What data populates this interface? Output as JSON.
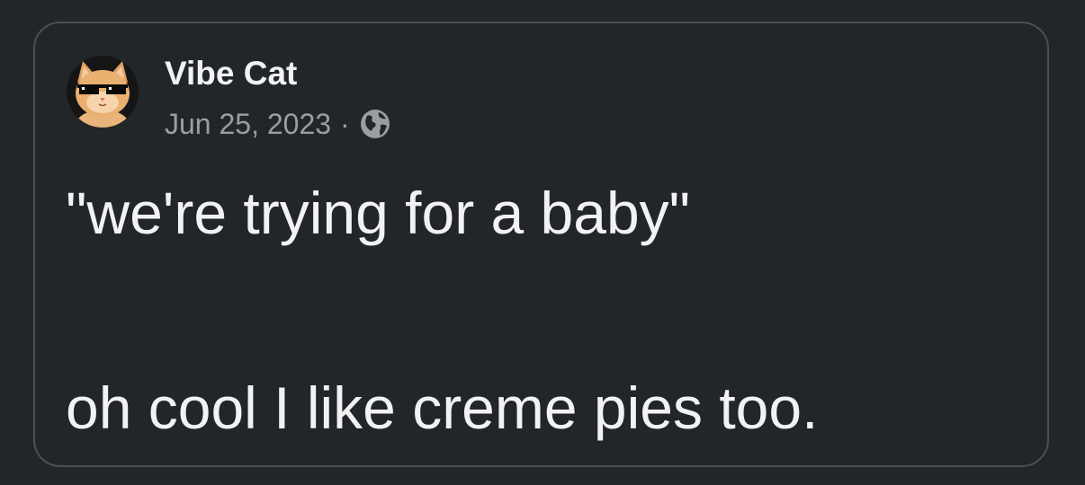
{
  "post": {
    "author": {
      "name": "Vibe Cat",
      "avatar_icon": "cat-with-sunglasses-avatar"
    },
    "date": "Jun 25, 2023",
    "separator": "·",
    "visibility_icon": "globe-icon",
    "text_lines": [
      "\"we're trying for a baby\"",
      "oh cool I like creme pies too."
    ]
  },
  "colors": {
    "background": "#232628",
    "border": "#4c4f52",
    "text": "#f2f2f4",
    "meta_text": "#9a9da2"
  }
}
